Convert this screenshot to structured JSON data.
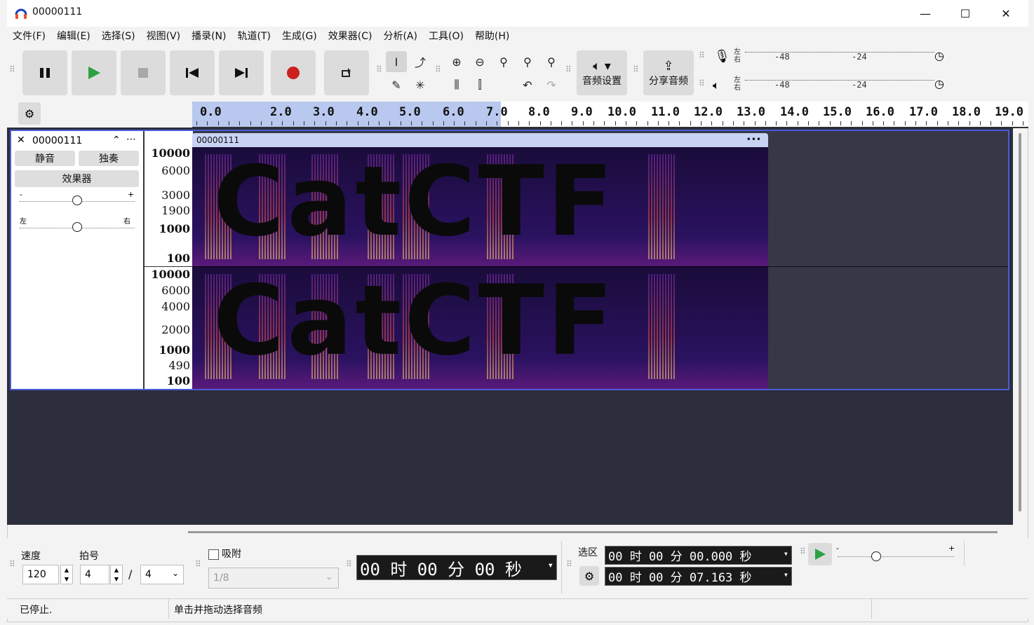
{
  "window": {
    "title": "00000111",
    "minimize": "—",
    "maximize": "☐",
    "close": "✕"
  },
  "menu": [
    "文件(F)",
    "编辑(E)",
    "选择(S)",
    "视图(V)",
    "播录(N)",
    "轨道(T)",
    "生成(G)",
    "效果器(C)",
    "分析(A)",
    "工具(O)",
    "帮助(H)"
  ],
  "toolbar": {
    "audio_setup_label": "音频设置",
    "share_audio_label": "分享音频",
    "meter_record": {
      "lr_top": "左",
      "lr_bottom": "右",
      "scale": [
        "-48",
        "-24"
      ]
    },
    "meter_play": {
      "lr_top": "左",
      "lr_bottom": "右",
      "scale": [
        "-48",
        "-24"
      ]
    }
  },
  "ruler": {
    "labels": [
      "0.0",
      "2.0",
      "3.0",
      "4.0",
      "5.0",
      "6.0",
      "7.0",
      "8.0",
      "9.0",
      "10.0",
      "11.0",
      "12.0",
      "13.0",
      "14.0",
      "15.0",
      "16.0",
      "17.0",
      "18.0",
      "19.0"
    ],
    "selection_end_seconds": 7.163
  },
  "track": {
    "name": "00000111",
    "mute_label": "静音",
    "solo_label": "独奏",
    "effects_label": "效果器",
    "gain_minus": "-",
    "gain_plus": "+",
    "pan_left": "左",
    "pan_right": "右",
    "gain_value": 0.5,
    "pan_value": 0.5,
    "clip_name": "00000111",
    "clip_menu": "•••",
    "freq_labels_top": [
      "10000",
      "6000",
      "3000",
      "1900",
      "1000",
      "100"
    ],
    "freq_labels_bottom": [
      "10000",
      "6000",
      "4000",
      "2000",
      "1000",
      "490",
      "100"
    ],
    "spectrogram_text": "CatCTF"
  },
  "bottom": {
    "tempo_label": "速度",
    "tempo_value": "120",
    "timesig_label": "拍号",
    "timesig_num": "4",
    "timesig_slash": "/",
    "timesig_den": "4",
    "snap_label": "吸附",
    "snap_value": "1/8",
    "time_display": "00 时 00 分 00 秒",
    "selection_label": "选区",
    "sel_start": "00 时 00 分 00.000 秒",
    "sel_end": "00 时 00 分 07.163 秒",
    "play_speed_minus": "-",
    "play_speed_plus": "+"
  },
  "status": {
    "left": "已停止.",
    "hint": "单击并拖动选择音频"
  },
  "colors": {
    "accent": "#4a5cd8",
    "play_green": "#2ea043",
    "record_red": "#cc1f1f",
    "ruler_selection": "#b8c8ef"
  }
}
